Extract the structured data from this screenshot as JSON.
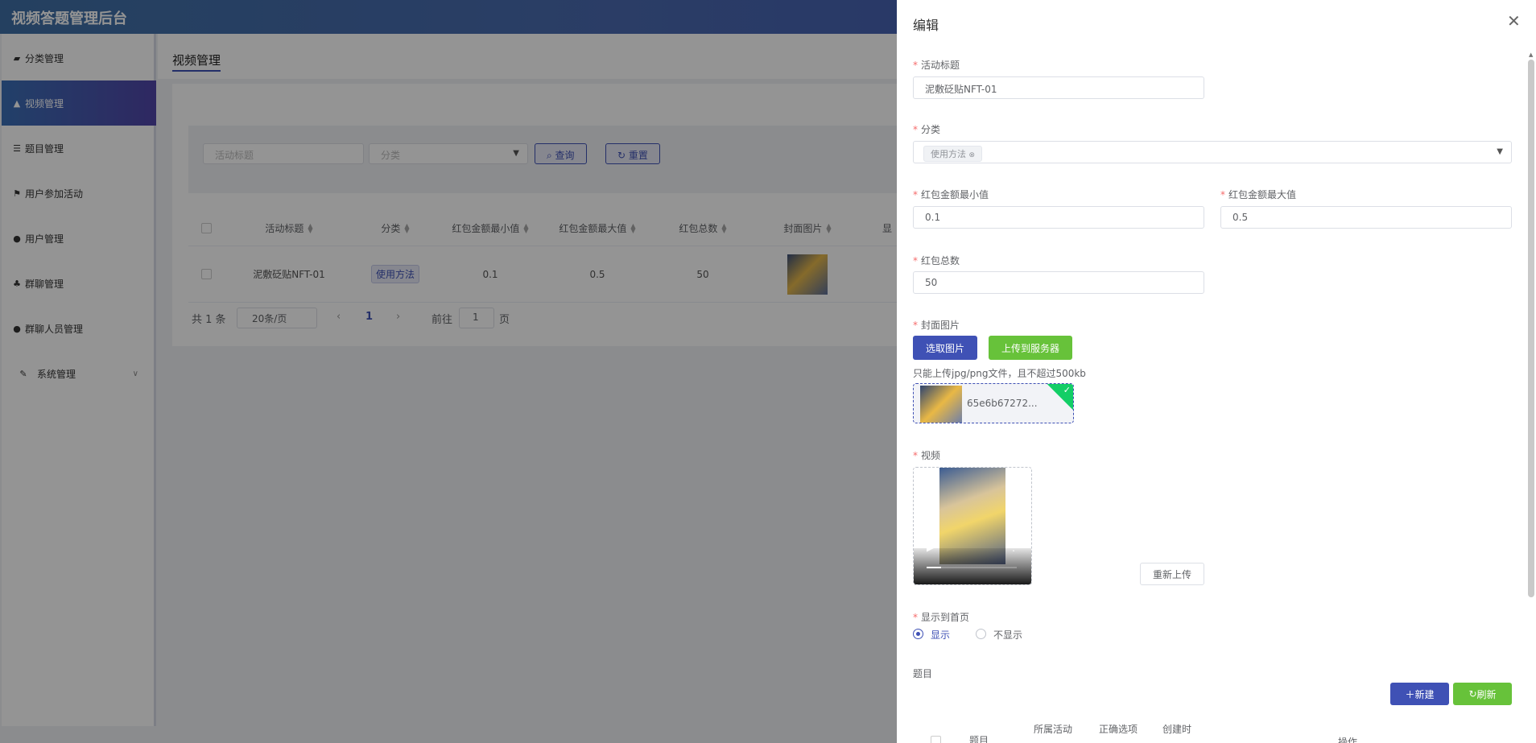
{
  "app": {
    "title": "视频答题管理后台"
  },
  "sidebar": {
    "items": [
      {
        "label": "分类管理",
        "icon": "briefcase-icon"
      },
      {
        "label": "视频管理",
        "icon": "graduation-cap-icon",
        "active": true
      },
      {
        "label": "题目管理",
        "icon": "list-icon"
      },
      {
        "label": "用户参加活动",
        "icon": "flag-icon"
      },
      {
        "label": "用户管理",
        "icon": "chat-icon"
      },
      {
        "label": "群聊管理",
        "icon": "sitemap-icon"
      },
      {
        "label": "群聊人员管理",
        "icon": "user-icon"
      },
      {
        "label": "系统管理",
        "icon": "wrench-icon",
        "expandable": true
      }
    ]
  },
  "main": {
    "tab_title": "视频管理",
    "search": {
      "title_placeholder": "活动标题",
      "category_placeholder": "分类",
      "query_label": "查询",
      "reset_label": "重置"
    },
    "table": {
      "headers": [
        "活动标题",
        "分类",
        "红包金额最小值",
        "红包金额最大值",
        "红包总数",
        "封面图片",
        "显"
      ],
      "rows": [
        {
          "title": "泥敷砭贴NFT-01",
          "category": "使用方法",
          "min": "0.1",
          "max": "0.5",
          "total": "50"
        }
      ]
    },
    "pager": {
      "total_text": "共 1 条",
      "page_size": "20条/页",
      "current_page": "1",
      "goto_label": "前往",
      "goto_value": "1",
      "page_suffix": "页"
    }
  },
  "drawer": {
    "title": "编辑",
    "fields": {
      "activity_title_label": "活动标题",
      "activity_title_value": "泥敷砭贴NFT-01",
      "category_label": "分类",
      "category_chip": "使用方法",
      "min_label": "红包金额最小值",
      "min_value": "0.1",
      "max_label": "红包金额最大值",
      "max_value": "0.5",
      "total_label": "红包总数",
      "total_value": "50",
      "cover_label": "封面图片",
      "select_image_label": "选取图片",
      "upload_server_label": "上传到服务器",
      "upload_hint": "只能上传jpg/png文件，且不超过500kb",
      "file_name": "65e6b67272...",
      "video_label": "视频",
      "reupload_label": "重新上传",
      "show_home_label": "显示到首页",
      "show_option": "显示",
      "hide_option": "不显示",
      "questions_label": "题目",
      "new_label": "新建",
      "refresh_label": "刷新"
    },
    "sub_table_headers": {
      "question": "题目",
      "activity": "所属活动",
      "correct": "正确选项",
      "created": "创建时",
      "action": "操作"
    }
  },
  "colors": {
    "primary": "#3f51b5",
    "success": "#67c23a",
    "danger": "#f56c6c"
  }
}
